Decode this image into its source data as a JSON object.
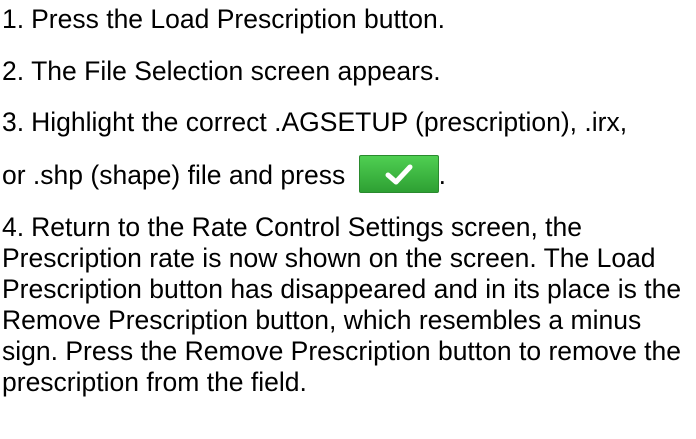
{
  "steps": [
    {
      "number": "1.",
      "text": "Press the Load Prescription button."
    },
    {
      "number": "2.",
      "text": "The File Selection screen appears."
    },
    {
      "number": "3.",
      "text": "Highlight the correct .AGSETUP (prescription), .irx,",
      "continuation": "or .shp (shape) file and press",
      "button_icon": "checkmark-icon",
      "after_button": "."
    },
    {
      "number": "4.",
      "text": "Return to the Rate Control Settings screen, the Prescription rate is now shown on the screen. The Load Prescription button has disappeared and in its place is the Remove Prescription button, which resembles a minus sign. Press the Remove Prescription button to remove the prescription from the field."
    }
  ],
  "colors": {
    "text": "#000000",
    "button_green": "#3cb83f",
    "check": "#ffffff"
  }
}
